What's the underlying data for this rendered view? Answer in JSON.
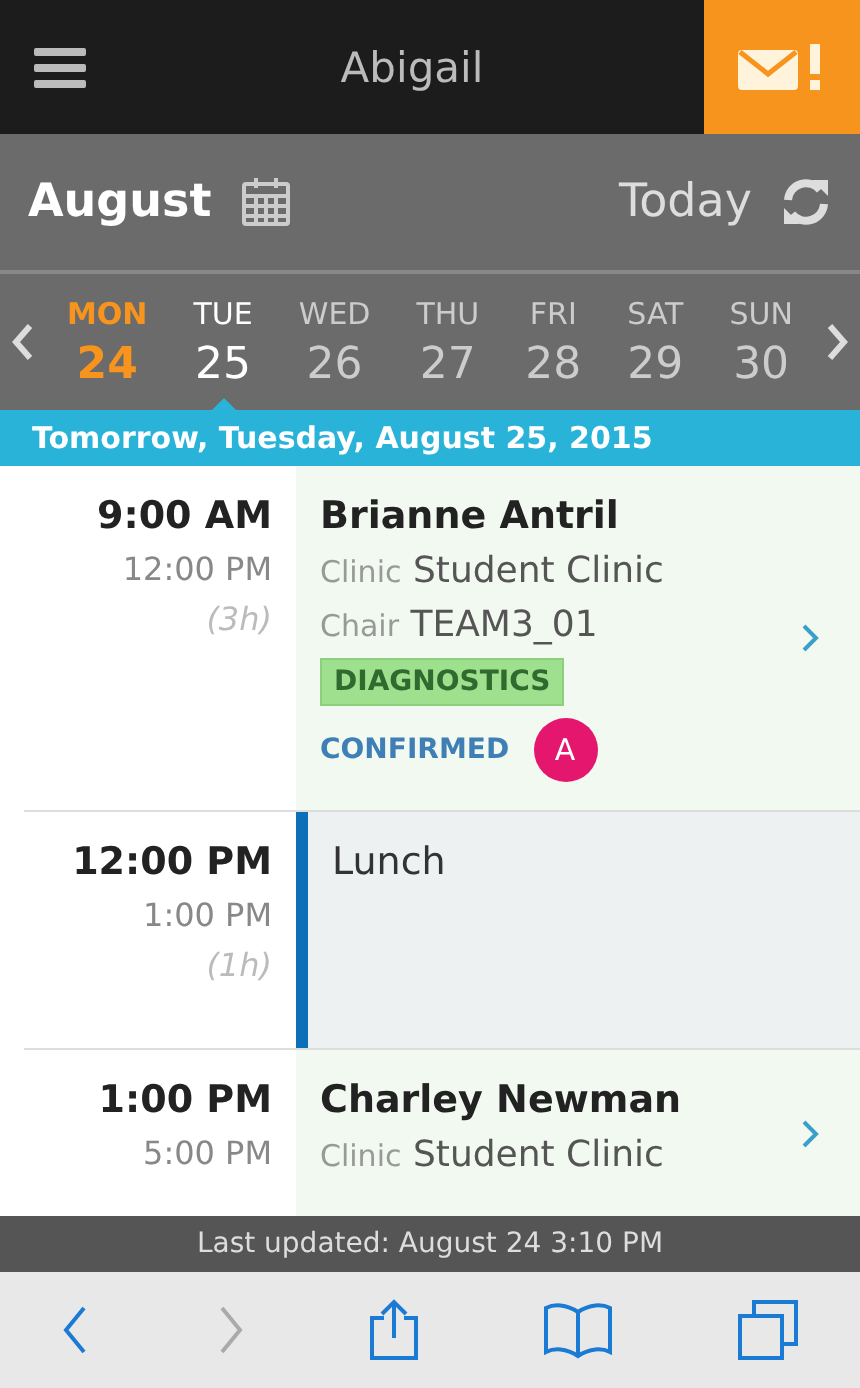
{
  "header": {
    "title": "Abigail"
  },
  "month_bar": {
    "month": "August",
    "today_label": "Today"
  },
  "week": [
    {
      "weekday": "MON",
      "date": "24",
      "today": true,
      "selected": false
    },
    {
      "weekday": "TUE",
      "date": "25",
      "today": false,
      "selected": true
    },
    {
      "weekday": "WED",
      "date": "26",
      "today": false,
      "selected": false
    },
    {
      "weekday": "THU",
      "date": "27",
      "today": false,
      "selected": false
    },
    {
      "weekday": "FRI",
      "date": "28",
      "today": false,
      "selected": false
    },
    {
      "weekday": "SAT",
      "date": "29",
      "today": false,
      "selected": false
    },
    {
      "weekday": "SUN",
      "date": "30",
      "today": false,
      "selected": false
    }
  ],
  "date_banner": "Tomorrow, Tuesday, August 25, 2015",
  "appointments": [
    {
      "kind": "patient",
      "start": "9:00 AM",
      "end": "12:00 PM",
      "duration": "(3h)",
      "title": "Brianne Antril",
      "details": [
        {
          "label": "Clinic",
          "value": "Student Clinic"
        },
        {
          "label": "Chair",
          "value": "TEAM3_01"
        }
      ],
      "tag": "DIAGNOSTICS",
      "status": "CONFIRMED",
      "badge": "A"
    },
    {
      "kind": "block",
      "start": "12:00 PM",
      "end": "1:00 PM",
      "duration": "(1h)",
      "title": "Lunch"
    },
    {
      "kind": "patient",
      "start": "1:00 PM",
      "end": "5:00 PM",
      "title": "Charley Newman",
      "details": [
        {
          "label": "Clinic",
          "value": "Student Clinic"
        }
      ]
    }
  ],
  "status_bar": "Last updated: August 24 3:10 PM"
}
